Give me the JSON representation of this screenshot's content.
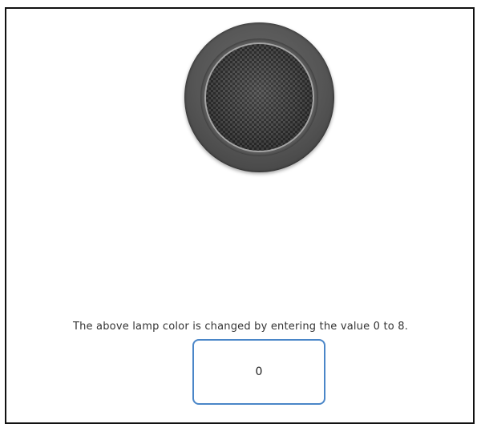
{
  "lamp": {
    "icon": "lamp-indicator",
    "state_value": "0",
    "outer_color": "#555555",
    "lens_color": "#4e4e4e"
  },
  "caption": "The above lamp color is changed by entering the value 0 to 8.",
  "input": {
    "value": "0",
    "border_color": "#4a86c8"
  }
}
